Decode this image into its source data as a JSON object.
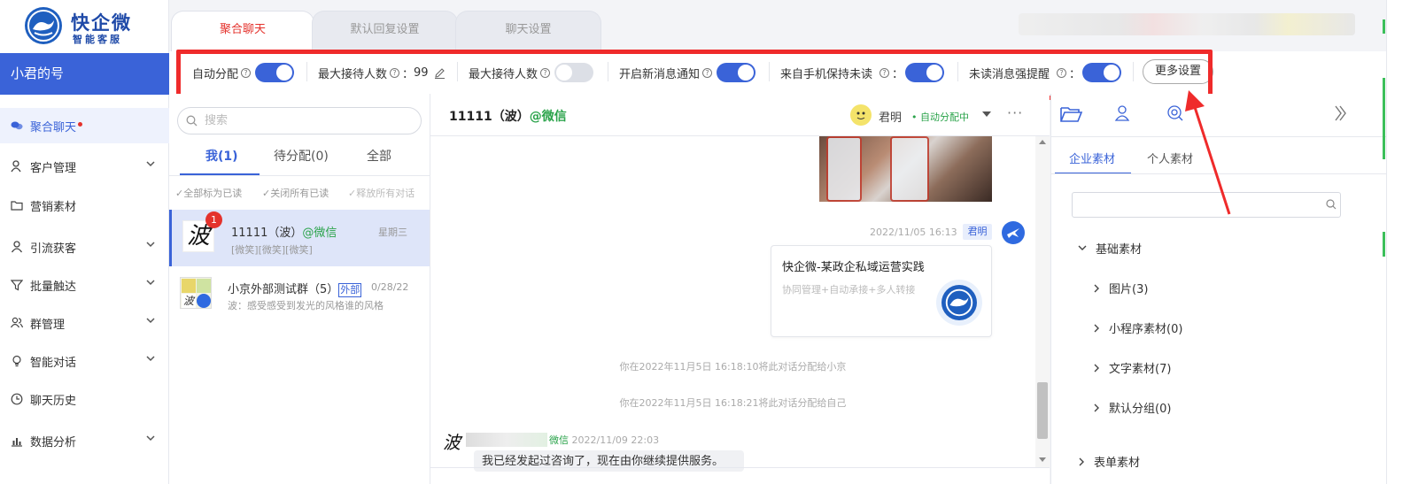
{
  "app": {
    "logo_title": "快企微",
    "logo_subtitle": "智能客服",
    "account_name": "小君的号"
  },
  "sidebar": {
    "items": [
      {
        "label": "聚合聊天",
        "icon": "chat-bubbles-icon",
        "active": true,
        "dot": true
      },
      {
        "label": "客户管理",
        "icon": "customer-icon",
        "chevron": true
      },
      {
        "label": "营销素材",
        "icon": "folder-icon"
      },
      {
        "label": "引流获客",
        "icon": "user-acquire-icon",
        "chevron": true
      },
      {
        "label": "批量触达",
        "icon": "funnel-icon",
        "chevron": true
      },
      {
        "label": "群管理",
        "icon": "group-icon",
        "chevron": true
      },
      {
        "label": "智能对话",
        "icon": "bulb-icon",
        "chevron": true
      },
      {
        "label": "聊天历史",
        "icon": "clock-icon"
      },
      {
        "label": "数据分析",
        "icon": "bar-chart-icon",
        "chevron": true
      }
    ]
  },
  "top_tabs": [
    {
      "label": "聚合聊天",
      "active": true
    },
    {
      "label": "默认回复设置"
    },
    {
      "label": "聊天设置"
    }
  ],
  "settings_bar": {
    "auto_assign_label": "自动分配",
    "auto_assign_on": true,
    "max_recv_label": "最大接待人数",
    "max_recv_value": "99",
    "max_recv2_label": "最大接待人数",
    "max_recv2_on": false,
    "new_msg_notify_label": "开启新消息通知",
    "new_msg_notify_on": true,
    "keep_unread_label": "来自手机保持未读",
    "keep_unread_on": true,
    "unread_remind_label": "未读消息强提醒",
    "unread_remind_on": true,
    "more_settings_label": "更多设置"
  },
  "conv_list": {
    "search_placeholder": "搜索",
    "tabs": [
      {
        "label": "我(1)",
        "active": true
      },
      {
        "label": "待分配(0)"
      },
      {
        "label": "全部"
      }
    ],
    "actions": [
      "✓全部标为已读",
      "✓关闭所有已读",
      "✓释放所有对话"
    ],
    "items": [
      {
        "avatar_char": "波",
        "badge": "1",
        "name": "11111（波）",
        "source": "@微信",
        "date": "星期三",
        "preview": "[微笑][微笑][微笑]",
        "selected": true
      },
      {
        "name": "小京外部测试群（5）",
        "tag": "外部",
        "date": "0/28/22",
        "preview": "波：感受感受到发光的风格谁的风格"
      }
    ]
  },
  "chat": {
    "title": "11111（波）",
    "title_source": "@微信",
    "agent_name": "君明",
    "assign_status": "• 自动分配中",
    "more": "···",
    "messages": {
      "out_time": "2022/11/05 16:13",
      "out_sender": "君明",
      "card_title": "快企微-某政企私域运营实践",
      "card_desc": "协同管理+自动承接+多人转接",
      "sys1": "你在2022年11月5日 16:18:10将此对话分配给小京",
      "sys2": "你在2022年11月5日 16:18:21将此对话分配给自己",
      "in_avatar_char": "波",
      "in_source": "微信",
      "in_time": "2022/11/09 22:03",
      "in_text": "我已经发起过咨询了，现在由你继续提供服务。"
    }
  },
  "right_panel": {
    "sub_tabs": [
      {
        "label": "企业素材",
        "active": true
      },
      {
        "label": "个人素材"
      }
    ],
    "tree": [
      {
        "label": "基础素材",
        "expanded": true,
        "level": 0
      },
      {
        "label": "图片(3)",
        "level": 1
      },
      {
        "label": "小程序素材(0)",
        "level": 1
      },
      {
        "label": "文字素材(7)",
        "level": 1
      },
      {
        "label": "默认分组(0)",
        "level": 1
      },
      {
        "label": "表单素材",
        "level": 0
      }
    ]
  },
  "colors": {
    "primary": "#3a63d8",
    "accent_red": "#e4322c",
    "annotation_red": "#ef2b2b",
    "wechat_green": "#2aa34a"
  }
}
